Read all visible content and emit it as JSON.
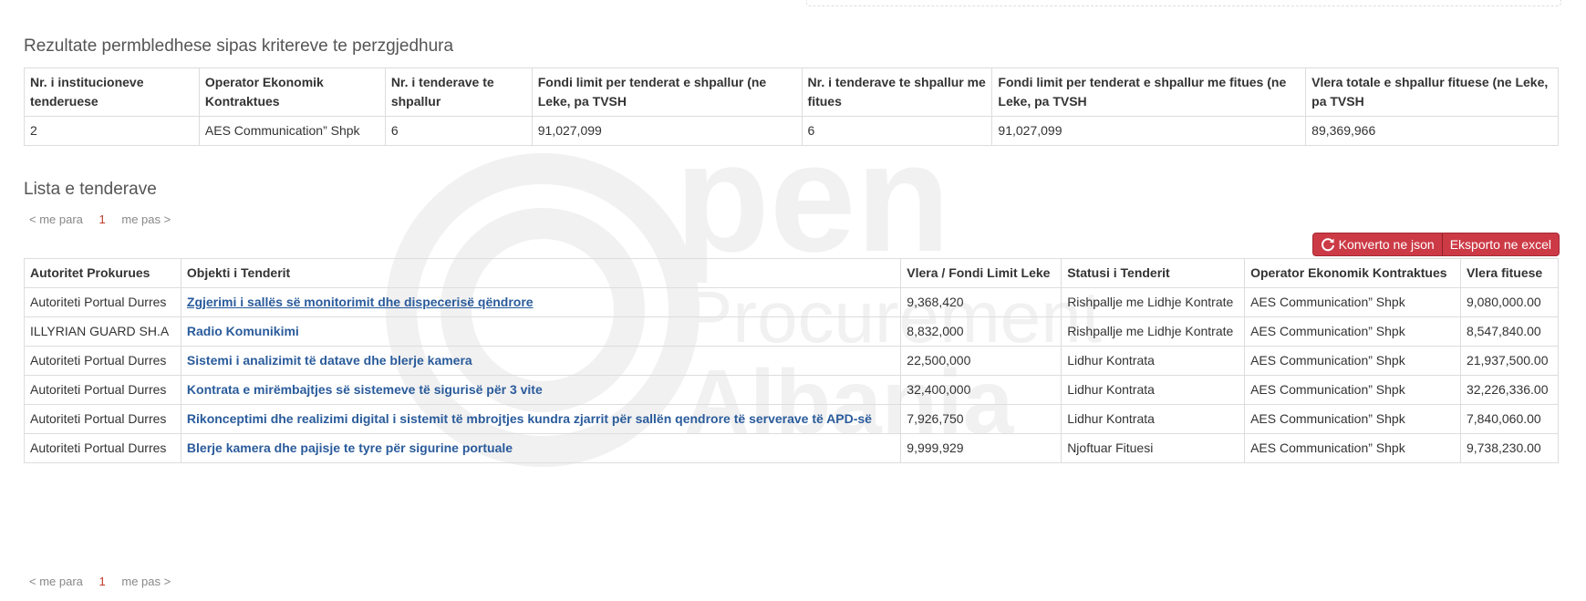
{
  "summary": {
    "title": "Rezultate permbledhese sipas kritereve te perzgjedhura",
    "headers": [
      "Nr. i institucioneve tenderuese",
      "Operator Ekonomik Kontraktues",
      "Nr. i tenderave te shpallur",
      "Fondi limit per tenderat e shpallur (ne Leke, pa TVSH",
      "Nr. i tenderave te shpallur me fitues",
      "Fondi limit per tenderat e shpallur me fitues (ne Leke, pa TVSH",
      "Vlera totale e shpallur fituese (ne Leke, pa TVSH"
    ],
    "row": [
      "2",
      "AES Communication” Shpk",
      "6",
      "91,027,099",
      "6",
      "91,027,099",
      "89,369,966"
    ]
  },
  "tenders": {
    "title": "Lista e tenderave",
    "pager": {
      "prev": "< me para",
      "current": "1",
      "next": "me pas >"
    },
    "buttons": {
      "json": "Konverto ne json",
      "excel": "Eksporto ne excel"
    },
    "headers": [
      "Autoritet Prokurues",
      "Objekti i Tenderit",
      "Vlera / Fondi Limit Leke",
      "Statusi i Tenderit",
      "Operator Ekonomik Kontraktues",
      "Vlera fituese"
    ],
    "rows": [
      [
        "Autoriteti Portual Durres",
        "Zgjerimi i sallës së monitorimit dhe dispecerisë qëndrore",
        "9,368,420",
        "Rishpallje me Lidhje Kontrate",
        "AES Communication” Shpk",
        "9,080,000.00"
      ],
      [
        "ILLYRIAN GUARD SH.A",
        "Radio Komunikimi",
        "8,832,000",
        "Rishpallje me Lidhje Kontrate",
        "AES Communication” Shpk",
        "8,547,840.00"
      ],
      [
        "Autoriteti Portual Durres",
        "Sistemi i analizimit të datave dhe blerje kamera",
        "22,500,000",
        "Lidhur Kontrata",
        "AES Communication” Shpk",
        "21,937,500.00"
      ],
      [
        "Autoriteti Portual Durres",
        "Kontrata e mirëmbajtjes së sistemeve të sigurisë për 3 vite",
        "32,400,000",
        "Lidhur Kontrata",
        "AES Communication” Shpk",
        "32,226,336.00"
      ],
      [
        "Autoriteti Portual Durres",
        "Rikonceptimi dhe realizimi digital i sistemit të mbrojtjes kundra zjarrit për sallën qendrore të serverave të APD-së",
        "7,926,750",
        "Lidhur Kontrata",
        "AES Communication” Shpk",
        "7,840,060.00"
      ],
      [
        "Autoriteti Portual Durres",
        "Blerje kamera dhe pajisje te tyre për sigurine portuale",
        "9,999,929",
        "Njoftuar Fituesi",
        "AES Communication” Shpk",
        "9,738,230.00"
      ]
    ]
  },
  "watermark": {
    "logo_text": "Open Procurement Albania",
    "color": "#f2f2f2"
  },
  "colors": {
    "link": "#2a5b9b",
    "button": "#cc3a46",
    "pager_current": "#c0392b"
  },
  "icons": {
    "json_button": "refresh-icon"
  }
}
